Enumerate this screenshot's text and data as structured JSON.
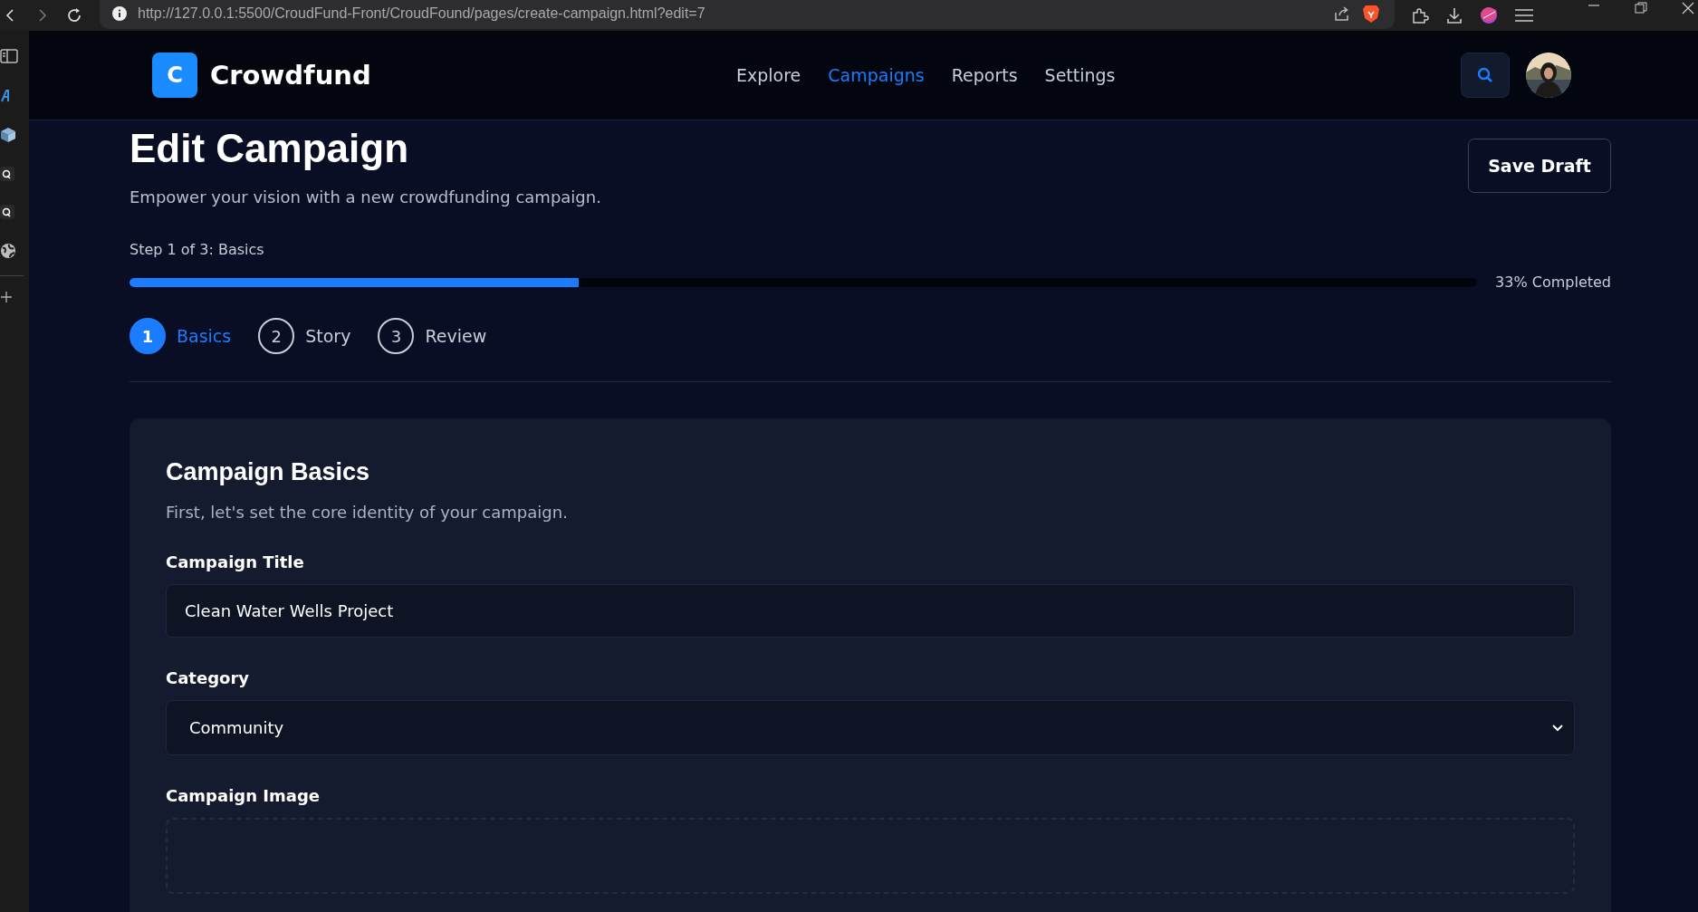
{
  "browser": {
    "url": "http://127.0.0.1:5500/CroudFund-Front/CroudFound/pages/create-campaign.html?edit=7"
  },
  "header": {
    "logo_letter": "C",
    "brand": "Crowdfund",
    "nav": [
      {
        "label": "Explore",
        "selected": false
      },
      {
        "label": "Campaigns",
        "selected": true
      },
      {
        "label": "Reports",
        "selected": false
      },
      {
        "label": "Settings",
        "selected": false
      }
    ]
  },
  "page": {
    "title": "Edit Campaign",
    "subtitle": "Empower your vision with a new crowdfunding campaign.",
    "save_button": "Save Draft",
    "step_label": "Step 1 of 3: Basics",
    "progress": {
      "level": 0.333,
      "reading": "33% Completed"
    },
    "steps": [
      {
        "number": "1",
        "label": "Basics",
        "selected": true
      },
      {
        "number": "2",
        "label": "Story",
        "selected": false
      },
      {
        "number": "3",
        "label": "Review",
        "selected": false
      }
    ]
  },
  "card": {
    "title": "Campaign Basics",
    "subtitle": "First, let's set the core identity of your campaign.",
    "fields": [
      {
        "kind": "text",
        "label": "Campaign Title",
        "value": "Clean Water Wells Project"
      },
      {
        "kind": "select",
        "label": "Category",
        "value": "Community"
      },
      {
        "kind": "dropzone",
        "label": "Campaign Image"
      }
    ]
  }
}
